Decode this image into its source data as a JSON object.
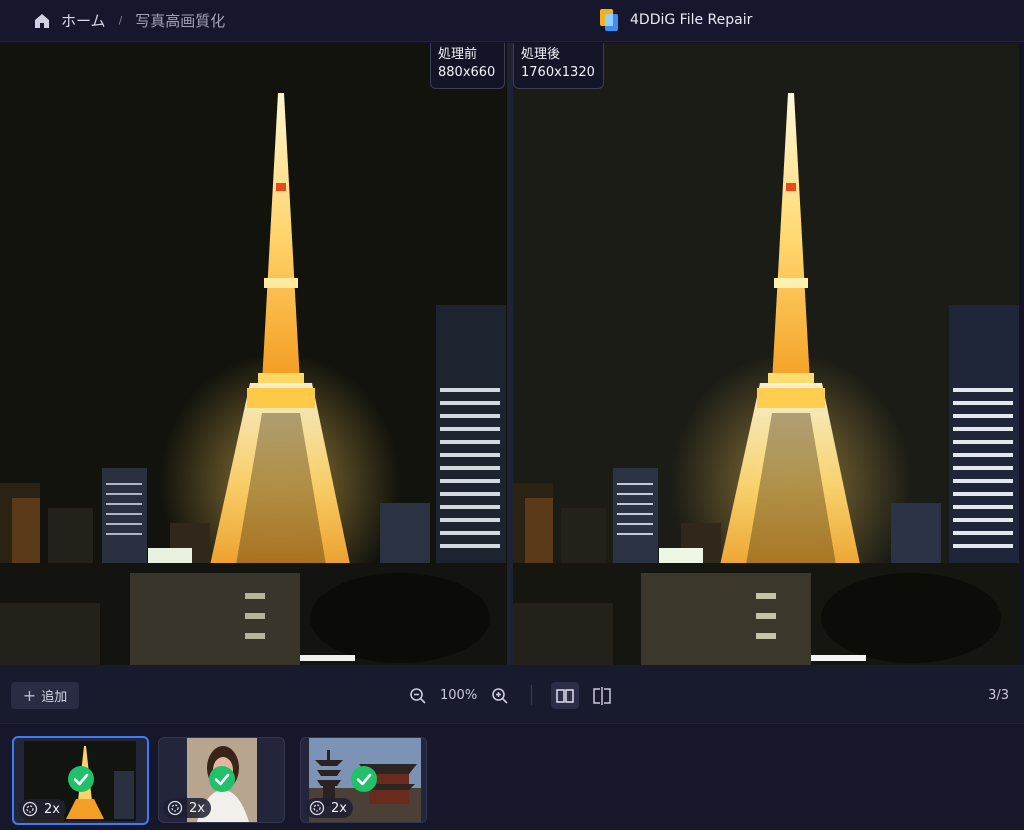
{
  "titlebar": {
    "home_label": "ホーム",
    "separator": "/",
    "current_label": "写真高画質化",
    "app_title": "4DDiG File Repair"
  },
  "preview": {
    "before": {
      "label": "処理前",
      "resolution": "880x660"
    },
    "after": {
      "label": "処理後",
      "resolution": "1760x1320"
    }
  },
  "toolbar": {
    "add_label": "追加",
    "zoom_level": "100%",
    "page_counter": "3/3"
  },
  "thumbnails": [
    {
      "scale": "2x",
      "status": "done",
      "selected": true,
      "icon": "tower-night-thumbnail"
    },
    {
      "scale": "2x",
      "status": "done",
      "selected": false,
      "icon": "portrait-thumbnail"
    },
    {
      "scale": "2x",
      "status": "done",
      "selected": false,
      "icon": "pagoda-thumbnail"
    }
  ],
  "colors": {
    "accent": "#3d7cf5",
    "success": "#21c06a",
    "background": "#121327"
  }
}
